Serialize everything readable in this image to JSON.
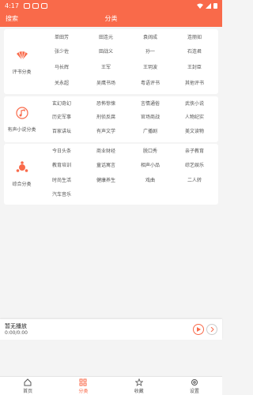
{
  "status": {
    "time": "4:17"
  },
  "header": {
    "search_label": "搜索",
    "title": "分类"
  },
  "sections": [
    {
      "label": "评书分类",
      "items": [
        "单田芳",
        "田连元",
        "袁阔成",
        "连丽如",
        "张少佐",
        "田战义",
        "孙一",
        "石连君",
        "马长辉",
        "王军",
        "王玥波",
        "王封臣",
        "关永超",
        "吴鹰书场",
        "粤语评书",
        "其他评书"
      ]
    },
    {
      "label": "有声小说分类",
      "items": [
        "玄幻奇幻",
        "恐怖惊悚",
        "言情通俗",
        "武侠小说",
        "历史军事",
        "刑侦反腐",
        "官场商战",
        "人物纪实",
        "百家讲坛",
        "有声文学",
        "广播剧",
        "美文读物"
      ]
    },
    {
      "label": "综合分类",
      "items": [
        "今日头条",
        "商业财经",
        "脱口秀",
        "亲子教育",
        "教育培训",
        "童话寓言",
        "相声小品",
        "综艺娱乐",
        "时尚生活",
        "健康养生",
        "戏曲",
        "二人转",
        "汽车音乐"
      ]
    }
  ],
  "player": {
    "title": "暂无播放",
    "time": "0:00/0:00"
  },
  "tabs": [
    {
      "label": "首页"
    },
    {
      "label": "分类"
    },
    {
      "label": "收藏"
    },
    {
      "label": "设置"
    }
  ],
  "colors": {
    "accent": "#f96a4a"
  }
}
